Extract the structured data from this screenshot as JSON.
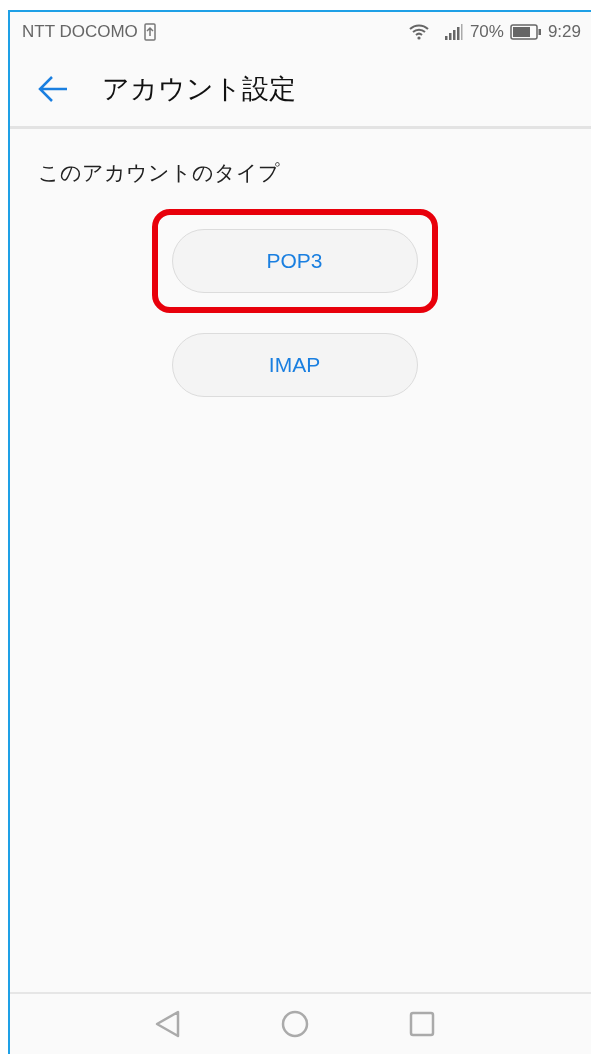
{
  "status_bar": {
    "carrier": "NTT DOCOMO",
    "battery": "70%",
    "time": "9:29"
  },
  "header": {
    "title": "アカウント設定"
  },
  "section": {
    "label": "このアカウントのタイプ"
  },
  "options": [
    {
      "label": "POP3",
      "highlighted": true
    },
    {
      "label": "IMAP",
      "highlighted": false
    }
  ]
}
